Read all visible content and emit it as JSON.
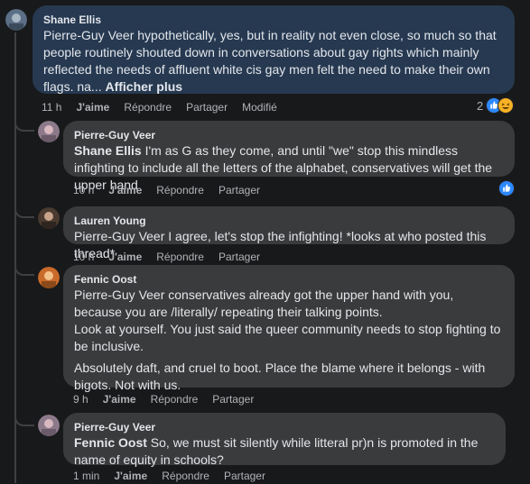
{
  "comments": [
    {
      "author": "Shane Ellis",
      "text": "Pierre-Guy Veer hypothetically, yes, but in reality not even close, so much so that people routinely shouted down in conversations about gay rights which mainly reflected the needs of affluent white cis gay men felt the need to make their own flags. na...",
      "more_label": "Afficher plus",
      "time": "11 h",
      "like": "J'aime",
      "reply": "Répondre",
      "share": "Partager",
      "edited": "Modifié",
      "reaction_count": "2"
    },
    {
      "author": "Pierre-Guy Veer",
      "mention": "Shane Ellis",
      "text": "I'm as G as they come, and until \"we\" stop this mindless infighting to include all the letters of the alphabet, conservatives will get the upper hand",
      "time": "10 h",
      "like": "J'aime",
      "reply": "Répondre",
      "share": "Partager"
    },
    {
      "author": "Lauren Young",
      "text": "Pierre-Guy Veer I agree, let's stop the infighting! *looks at who posted this thread*",
      "time": "10 h",
      "like": "J'aime",
      "reply": "Répondre",
      "share": "Partager"
    },
    {
      "author": "Fennic Oost",
      "text_p1": "Pierre-Guy Veer conservatives already got the upper hand with you, because you are /literally/ repeating their talking points.",
      "text_p2": "Look at yourself. You just said the queer community needs to stop fighting to be inclusive.",
      "text_p3": "Absolutely daft, and cruel to boot. Place the blame where it belongs - with bigots. Not with us.",
      "time": "9 h",
      "like": "J'aime",
      "reply": "Répondre",
      "share": "Partager"
    },
    {
      "author": "Pierre-Guy Veer",
      "mention": "Fennic Oost",
      "text": "So, we must sit silently while litteral pr)n is promoted in the name of equity in schools?",
      "time": "1 min",
      "like": "J'aime",
      "reply": "Répondre",
      "share": "Partager"
    }
  ],
  "colors": {
    "background": "#18191a",
    "bubble": "#3a3b3c",
    "highlight_bubble": "#263951",
    "like_blue": "#2d88ff"
  }
}
